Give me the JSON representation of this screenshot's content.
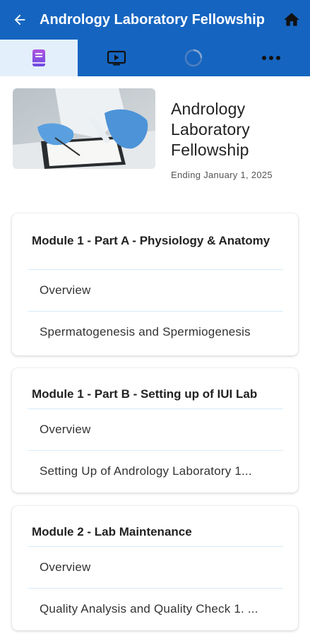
{
  "header": {
    "title": "Andrology Laboratory Fellowship",
    "back_icon": "arrow-left-icon",
    "home_icon": "home-icon",
    "color": "#1565c0"
  },
  "tabs": [
    {
      "icon": "book-icon",
      "active": true
    },
    {
      "icon": "video-play-icon",
      "active": false
    },
    {
      "icon": "progress-ring-icon",
      "active": false
    },
    {
      "icon": "more-horizontal-icon",
      "active": false
    }
  ],
  "course": {
    "title": "Andrology Laboratory Fellowship",
    "ending": "Ending January 1, 2025"
  },
  "modules": [
    {
      "title": "Module 1 - Part A - Physiology & Anatomy",
      "items": [
        "Overview",
        "Spermatogenesis and Spermiogenesis"
      ]
    },
    {
      "title": "Module 1 - Part B - Setting up of IUI Lab",
      "items": [
        "Overview",
        "Setting Up of Andrology Laboratory 1..."
      ]
    },
    {
      "title": "Module 2 - Lab Maintenance",
      "items": [
        "Overview",
        "Quality Analysis and Quality Check 1. ..."
      ]
    }
  ]
}
